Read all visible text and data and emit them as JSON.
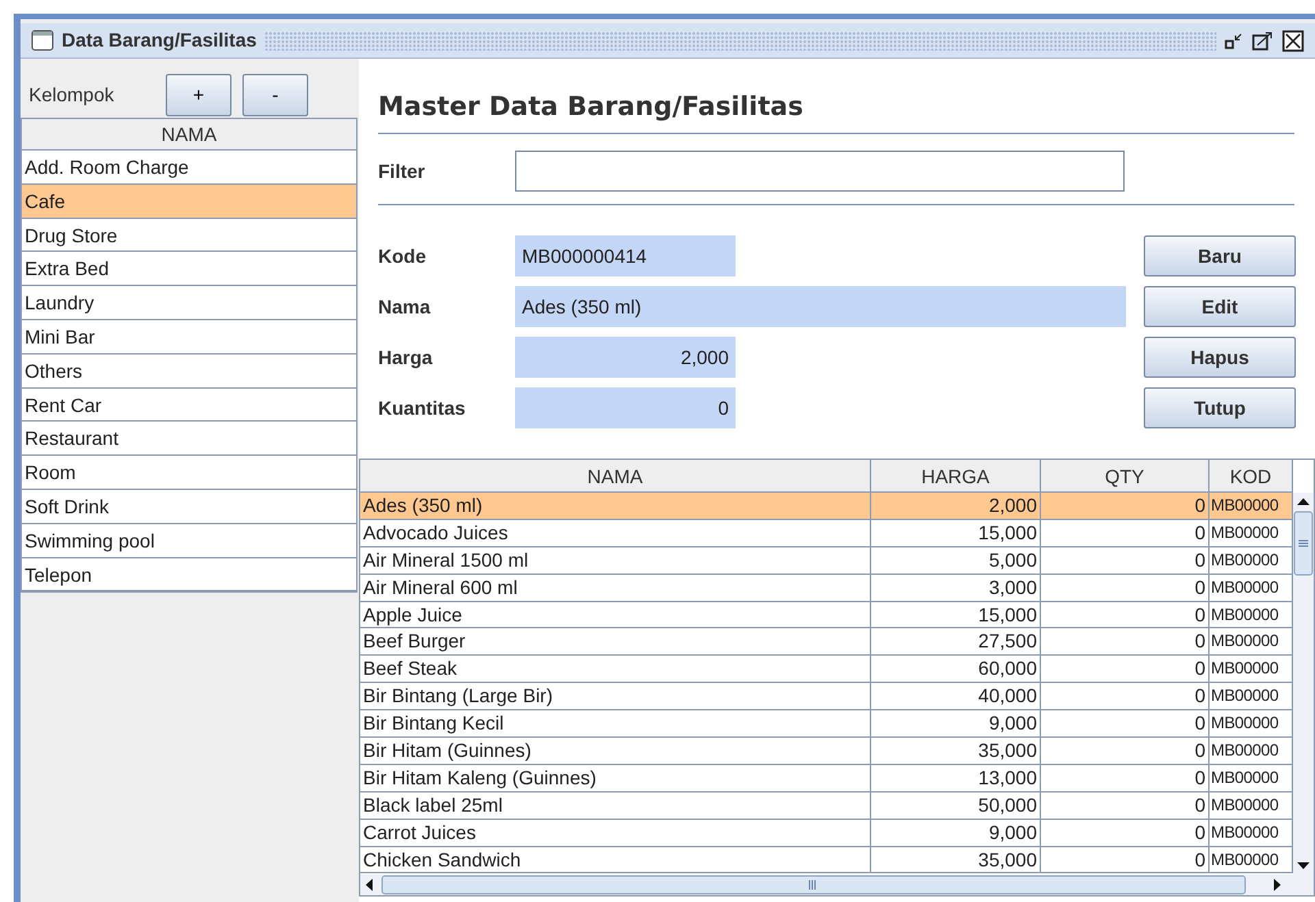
{
  "window": {
    "title": "Data Barang/Fasilitas"
  },
  "groups": {
    "label": "Kelompok",
    "buttons": [
      "+",
      "-"
    ],
    "column": "NAMA",
    "items": [
      {
        "label": "Add. Room Charge",
        "selected": false
      },
      {
        "label": "Cafe",
        "selected": true
      },
      {
        "label": "Drug Store",
        "selected": false
      },
      {
        "label": "Extra Bed",
        "selected": false
      },
      {
        "label": "Laundry",
        "selected": false
      },
      {
        "label": "Mini Bar",
        "selected": false
      },
      {
        "label": "Others",
        "selected": false
      },
      {
        "label": "Rent Car",
        "selected": false
      },
      {
        "label": "Restaurant",
        "selected": false
      },
      {
        "label": "Room",
        "selected": false
      },
      {
        "label": "Soft Drink",
        "selected": false
      },
      {
        "label": "Swimming pool",
        "selected": false
      },
      {
        "label": "Telepon",
        "selected": false
      }
    ]
  },
  "heading": "Master Data Barang/Fasilitas",
  "filter": {
    "label": "Filter"
  },
  "fields": [
    {
      "label": "Kode",
      "value": "MB000000414",
      "kind": "short"
    },
    {
      "label": "Nama",
      "value": "Ades (350 ml)",
      "kind": "long"
    },
    {
      "label": "Harga",
      "value": "2,000",
      "kind": "number"
    },
    {
      "label": "Kuantitas",
      "value": "0",
      "kind": "number"
    }
  ],
  "actions": [
    "Baru",
    "Edit",
    "Hapus",
    "Tutup"
  ],
  "table": {
    "columns": [
      "NAMA",
      "HARGA",
      "QTY",
      "KOD"
    ],
    "rows": [
      {
        "cells": [
          "Ades (350 ml)",
          "2,000",
          "0",
          "MB00000"
        ],
        "selected": true
      },
      {
        "cells": [
          "Advocado Juices",
          "15,000",
          "0",
          "MB00000"
        ],
        "selected": false
      },
      {
        "cells": [
          "Air Mineral 1500 ml",
          "5,000",
          "0",
          "MB00000"
        ],
        "selected": false
      },
      {
        "cells": [
          "Air Mineral 600 ml",
          "3,000",
          "0",
          "MB00000"
        ],
        "selected": false
      },
      {
        "cells": [
          "Apple Juice",
          "15,000",
          "0",
          "MB00000"
        ],
        "selected": false
      },
      {
        "cells": [
          "Beef Burger",
          "27,500",
          "0",
          "MB00000"
        ],
        "selected": false
      },
      {
        "cells": [
          "Beef Steak",
          "60,000",
          "0",
          "MB00000"
        ],
        "selected": false
      },
      {
        "cells": [
          "Bir Bintang (Large Bir)",
          "40,000",
          "0",
          "MB00000"
        ],
        "selected": false
      },
      {
        "cells": [
          "Bir Bintang Kecil",
          "9,000",
          "0",
          "MB00000"
        ],
        "selected": false
      },
      {
        "cells": [
          "Bir Hitam (Guinnes)",
          "35,000",
          "0",
          "MB00000"
        ],
        "selected": false
      },
      {
        "cells": [
          "Bir Hitam Kaleng (Guinnes)",
          "13,000",
          "0",
          "MB00000"
        ],
        "selected": false
      },
      {
        "cells": [
          "Black label 25ml",
          "50,000",
          "0",
          "MB00000"
        ],
        "selected": false
      },
      {
        "cells": [
          "Carrot Juices",
          "9,000",
          "0",
          "MB00000"
        ],
        "selected": false
      },
      {
        "cells": [
          "Chicken Sandwich",
          "35,000",
          "0",
          "MB00000"
        ],
        "selected": false
      }
    ]
  }
}
